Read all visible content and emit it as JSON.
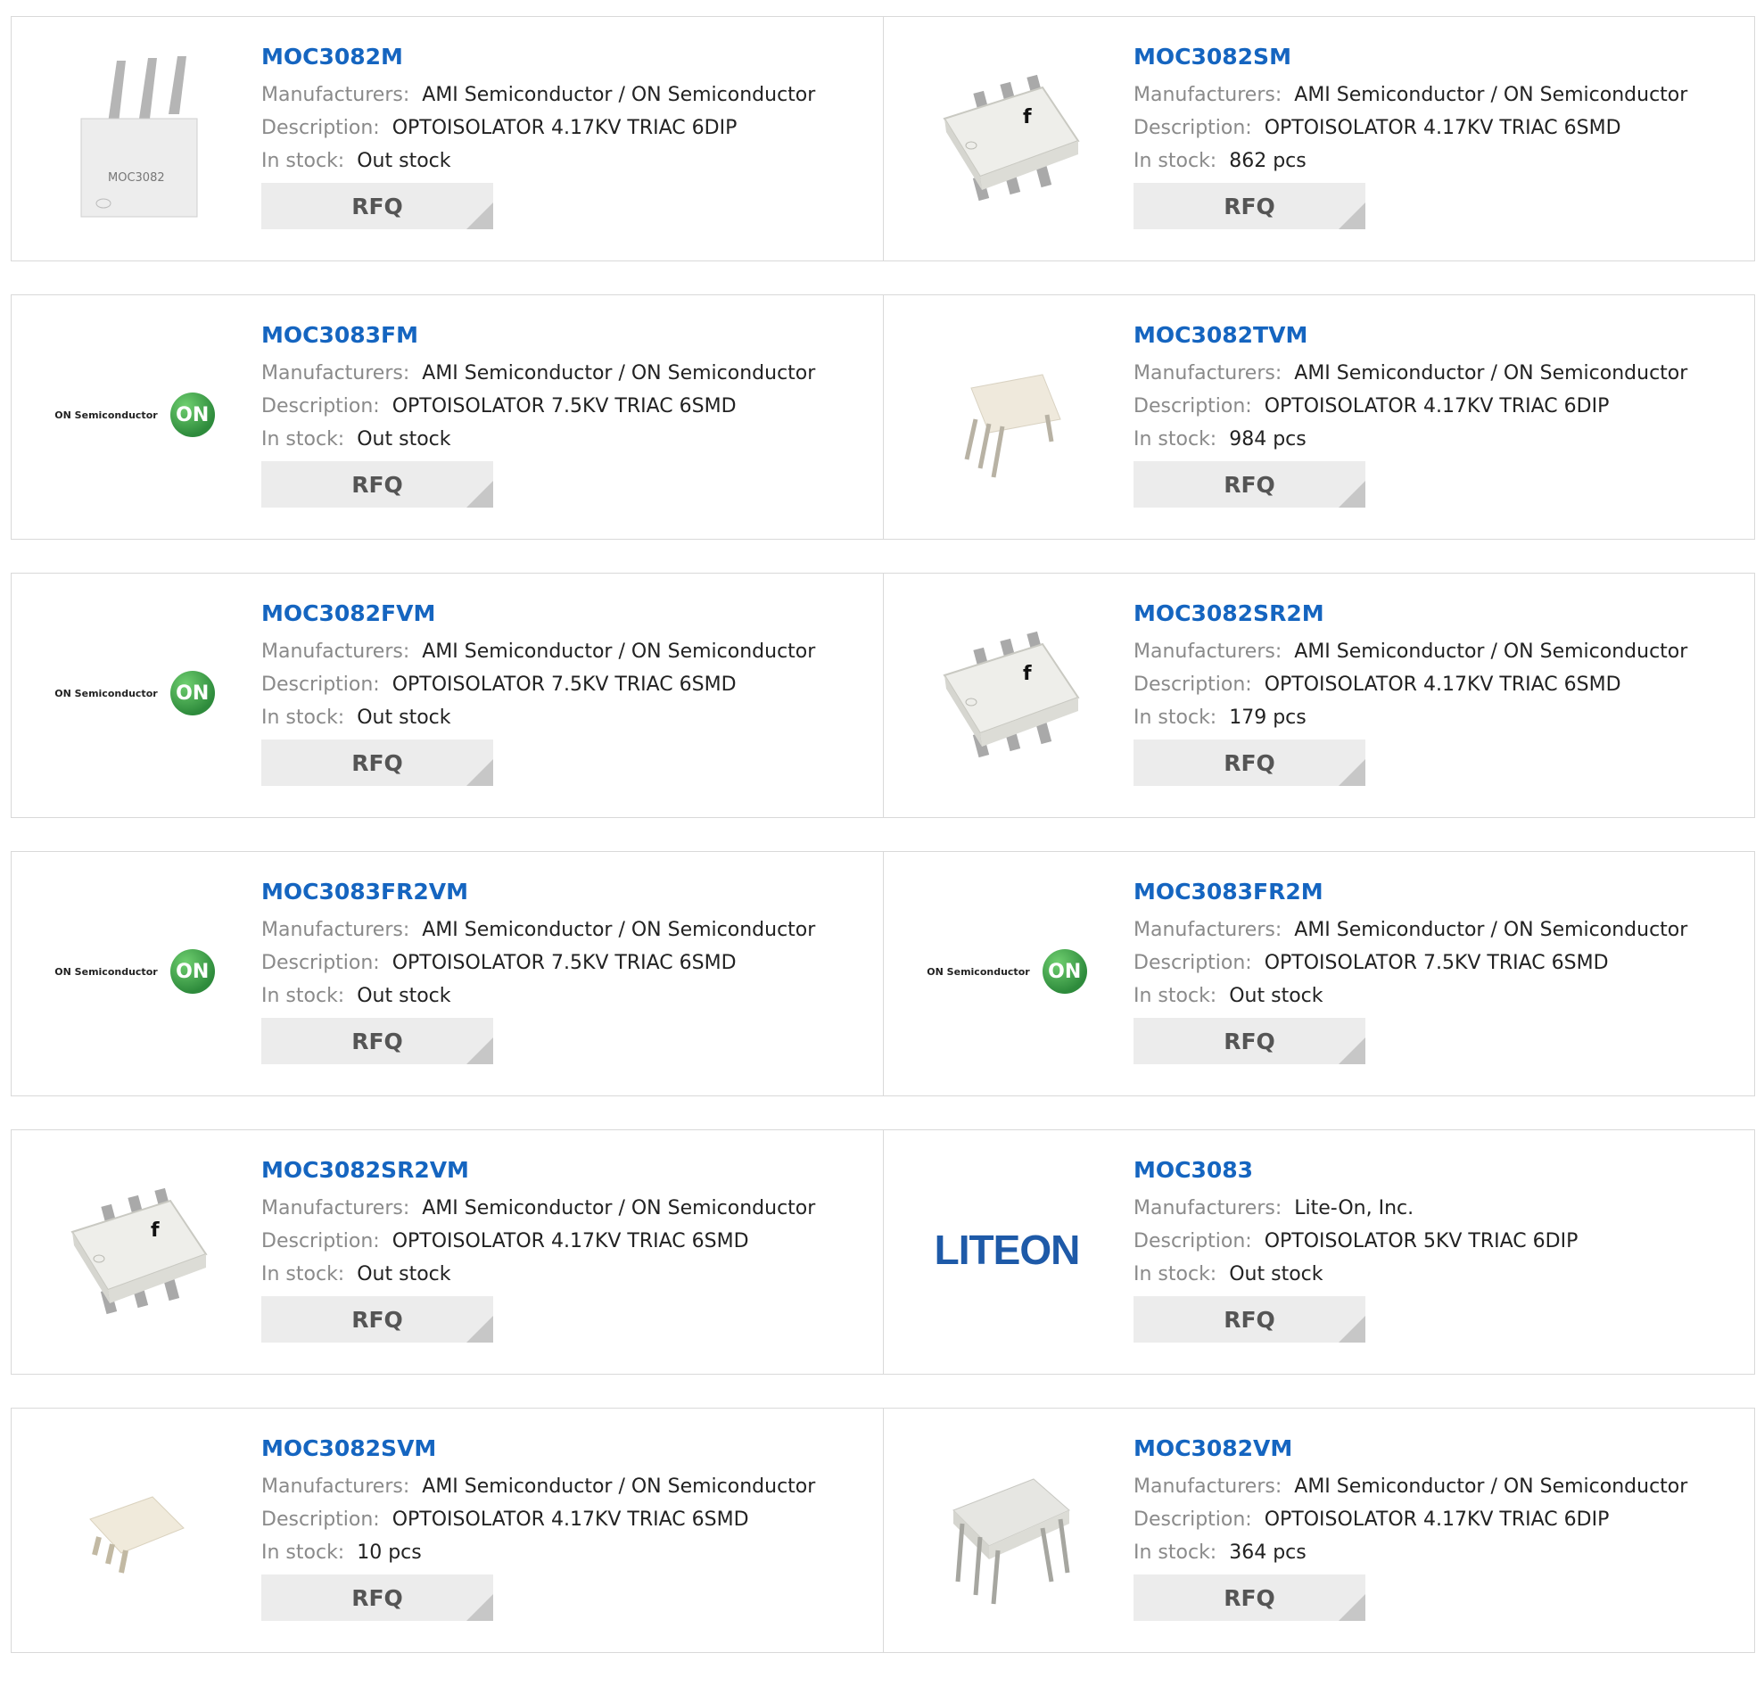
{
  "labels": {
    "manufacturers": "Manufacturers:",
    "description": "Description:",
    "in_stock": "In stock:",
    "rfq": "RFQ"
  },
  "logo_text": {
    "on_semi": "ON Semiconductor",
    "on": "ON",
    "liteon": "LITEON"
  },
  "colors": {
    "title_link": "#1565c0",
    "rfq_bg": "#ececec",
    "on_logo_green": "#2e8b3c"
  },
  "products": [
    {
      "name": "MOC3082M",
      "manufacturer": "AMI Semiconductor / ON Semiconductor",
      "description": "OPTOISOLATOR 4.17KV TRIAC 6DIP",
      "stock": "Out stock",
      "image": "dip-chip-vertical-pins"
    },
    {
      "name": "MOC3082SM",
      "manufacturer": "AMI Semiconductor / ON Semiconductor",
      "description": "OPTOISOLATOR 4.17KV TRIAC 6SMD",
      "stock": "862 pcs",
      "image": "smd-chip"
    },
    {
      "name": "MOC3083FM",
      "manufacturer": "AMI Semiconductor / ON Semiconductor",
      "description": "OPTOISOLATOR 7.5KV TRIAC 6SMD",
      "stock": "Out stock",
      "image": "on-semi-logo"
    },
    {
      "name": "MOC3082TVM",
      "manufacturer": "AMI Semiconductor / ON Semiconductor",
      "description": "OPTOISOLATOR 4.17KV TRIAC 6DIP",
      "stock": "984 pcs",
      "image": "dip-chip-cream"
    },
    {
      "name": "MOC3082FVM",
      "manufacturer": "AMI Semiconductor / ON Semiconductor",
      "description": "OPTOISOLATOR 7.5KV TRIAC 6SMD",
      "stock": "Out stock",
      "image": "on-semi-logo"
    },
    {
      "name": "MOC3082SR2M",
      "manufacturer": "AMI Semiconductor / ON Semiconductor",
      "description": "OPTOISOLATOR 4.17KV TRIAC 6SMD",
      "stock": "179 pcs",
      "image": "smd-chip"
    },
    {
      "name": "MOC3083FR2VM",
      "manufacturer": "AMI Semiconductor / ON Semiconductor",
      "description": "OPTOISOLATOR 7.5KV TRIAC 6SMD",
      "stock": "Out stock",
      "image": "on-semi-logo"
    },
    {
      "name": "MOC3083FR2M",
      "manufacturer": "AMI Semiconductor / ON Semiconductor",
      "description": "OPTOISOLATOR 7.5KV TRIAC 6SMD",
      "stock": "Out stock",
      "image": "on-semi-logo"
    },
    {
      "name": "MOC3082SR2VM",
      "manufacturer": "AMI Semiconductor / ON Semiconductor",
      "description": "OPTOISOLATOR 4.17KV TRIAC 6SMD",
      "stock": "Out stock",
      "image": "smd-chip"
    },
    {
      "name": "MOC3083",
      "manufacturer": "Lite-On, Inc.",
      "description": "OPTOISOLATOR 5KV TRIAC 6DIP",
      "stock": "Out stock",
      "image": "liteon-logo"
    },
    {
      "name": "MOC3082SVM",
      "manufacturer": "AMI Semiconductor / ON Semiconductor",
      "description": "OPTOISOLATOR 4.17KV TRIAC 6SMD",
      "stock": "10 pcs",
      "image": "smd-chip-cream"
    },
    {
      "name": "MOC3082VM",
      "manufacturer": "AMI Semiconductor / ON Semiconductor",
      "description": "OPTOISOLATOR 4.17KV TRIAC 6DIP",
      "stock": "364 pcs",
      "image": "dip-chip-gray"
    }
  ]
}
